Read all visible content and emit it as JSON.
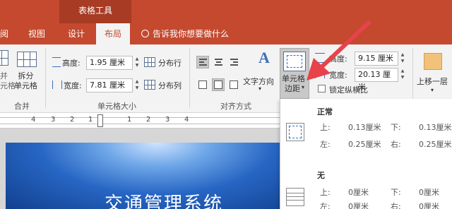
{
  "title_bar": {
    "context_group": "表格工具"
  },
  "tabs": [
    {
      "label": "阅"
    },
    {
      "label": "视图"
    },
    {
      "label": "设计"
    },
    {
      "label": "布局"
    }
  ],
  "tell_me": "告诉我你想要做什么",
  "ribbon": {
    "merge": {
      "partial_label": "并\n元格",
      "split_label": "拆分\n单元格",
      "group_label": "合并"
    },
    "cell_size": {
      "height_label": "高度:",
      "height_value": "1.95 厘米",
      "width_label": "宽度:",
      "width_value": "7.81 厘米",
      "distribute_rows": "分布行",
      "distribute_cols": "分布列",
      "group_label": "单元格大小"
    },
    "alignment": {
      "text_direction": "文字方向",
      "group_label": "对齐方式"
    },
    "cell_margins": {
      "label_line1": "单元格",
      "label_line2": "边距"
    },
    "table_size": {
      "height_label": "高度:",
      "height_value": "9.15 厘米",
      "width_label": "宽度:",
      "width_value": "20.13 厘米",
      "lock_ratio": "锁定纵横比"
    },
    "arrange": {
      "bring_forward": "上移一层"
    }
  },
  "ruler_numbers": [
    "4",
    "3",
    "2",
    "1",
    "1",
    "2",
    "3",
    "4"
  ],
  "dropdown": {
    "sections": [
      {
        "title": "正常",
        "top_label": "上:",
        "top_value": "0.13厘米",
        "bottom_label": "下:",
        "bottom_value": "0.13厘米",
        "left_label": "左:",
        "left_value": "0.25厘米",
        "right_label": "右:",
        "right_value": "0.25厘米"
      },
      {
        "title": "无",
        "top_label": "上:",
        "top_value": "0厘米",
        "bottom_label": "下:",
        "bottom_value": "0厘米",
        "left_label": "左:",
        "left_value": "0厘米",
        "right_label": "右:",
        "right_value": "0厘米"
      }
    ]
  },
  "slide": {
    "title": "交通管理系统"
  },
  "colors": {
    "accent": "#c4492e",
    "arrow": "#e8424a"
  }
}
